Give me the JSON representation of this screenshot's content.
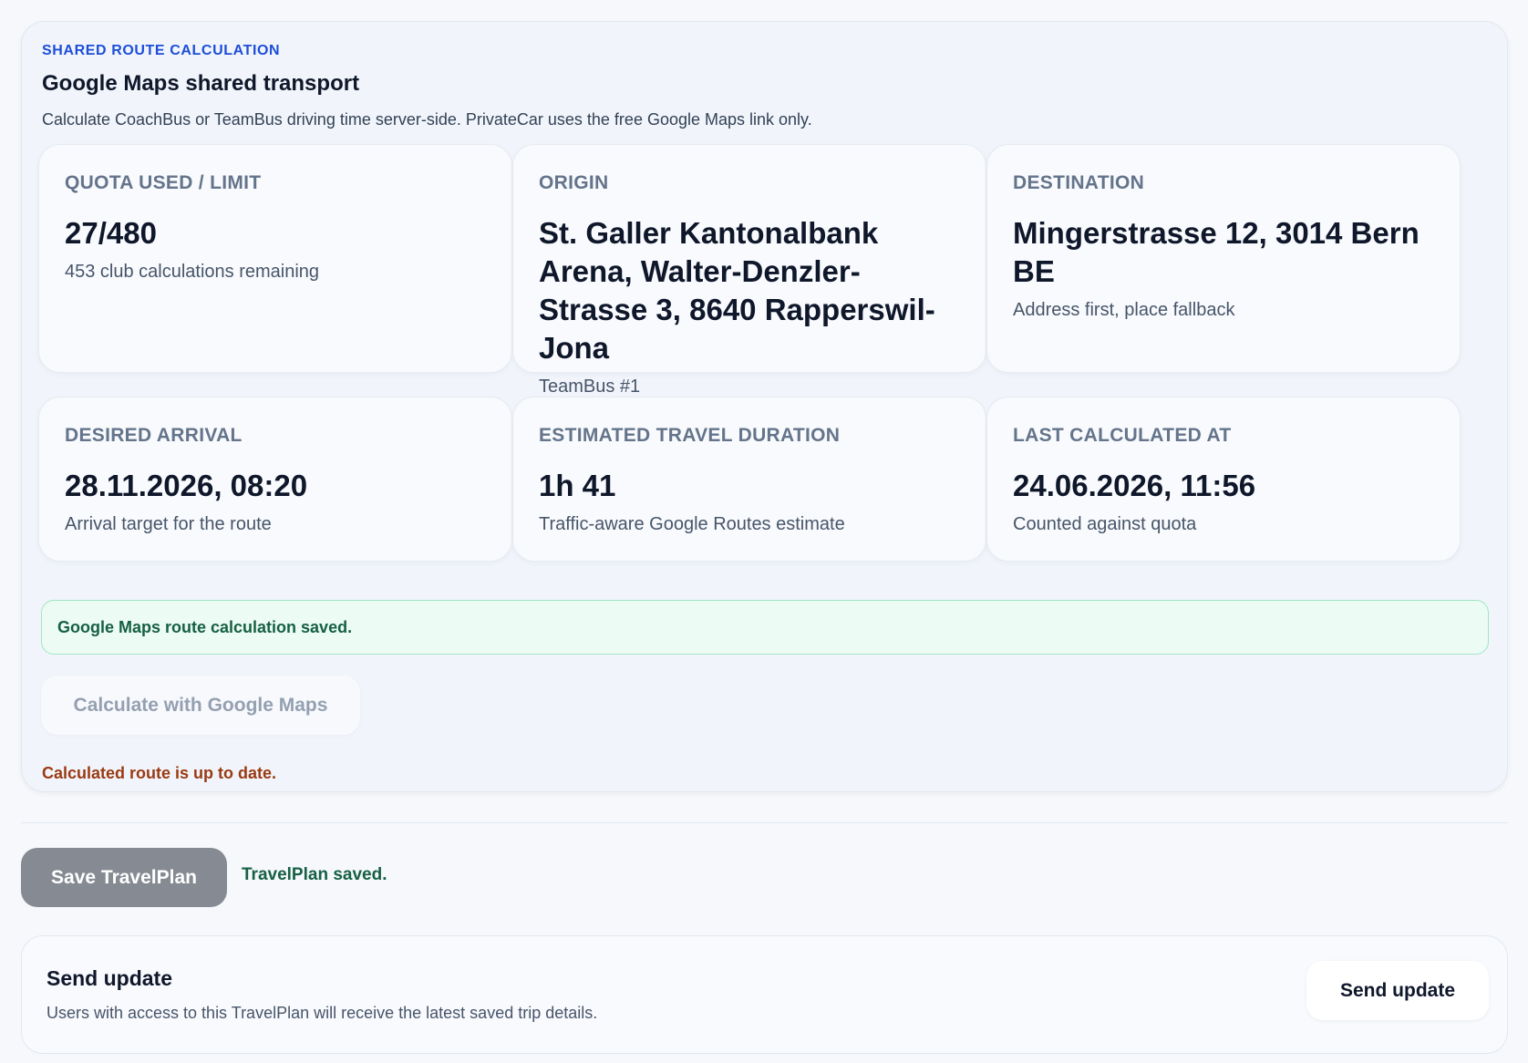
{
  "route_panel": {
    "eyebrow": "SHARED ROUTE CALCULATION",
    "title": "Google Maps shared transport",
    "description": "Calculate CoachBus or TeamBus driving time server-side. PrivateCar uses the free Google Maps link only."
  },
  "cards": {
    "quota": {
      "label": "QUOTA USED / LIMIT",
      "value": "27/480",
      "sub": "453 club calculations remaining"
    },
    "origin": {
      "label": "ORIGIN",
      "value": "St. Galler Kantonalbank Arena, Walter-Denzler-Strasse 3, 8640 Rapperswil-Jona",
      "sub": "TeamBus #1"
    },
    "destination": {
      "label": "DESTINATION",
      "value": "Mingerstrasse 12, 3014 Bern BE",
      "sub": "Address first, place fallback"
    },
    "arrival": {
      "label": "DESIRED ARRIVAL",
      "value": "28.11.2026, 08:20",
      "sub": "Arrival target for the route"
    },
    "duration": {
      "label": "ESTIMATED TRAVEL DURATION",
      "value": "1h 41",
      "sub": "Traffic-aware Google Routes estimate"
    },
    "last_calculated": {
      "label": "LAST CALCULATED AT",
      "value": "24.06.2026, 11:56",
      "sub": "Counted against quota"
    }
  },
  "notice": {
    "text": "Google Maps route calculation saved."
  },
  "calculate": {
    "button_label": "Calculate with Google Maps",
    "status": "Calculated route is up to date."
  },
  "save": {
    "button_label": "Save TravelPlan",
    "status": "TravelPlan saved."
  },
  "update": {
    "title": "Send update",
    "description": "Users with access to this TravelPlan will receive the latest saved trip details.",
    "button_label": "Send update"
  },
  "colors": {
    "accent": "#1d4ed8",
    "success_text": "#166044",
    "success_bg": "#ecfbf4",
    "warning_text": "#9a3a12",
    "save_button_bg": "#868b93"
  }
}
